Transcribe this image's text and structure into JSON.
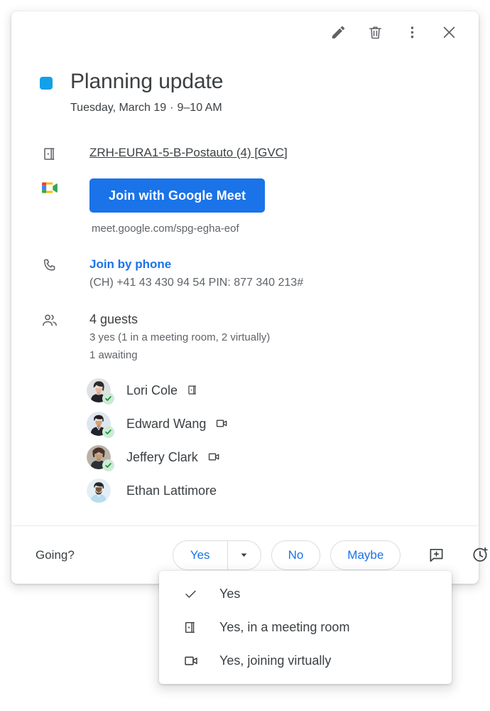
{
  "colors": {
    "event_dot": "#12a0e8",
    "primary_blue": "#1a73e8",
    "text_primary": "#3c4043",
    "text_secondary": "#5f6368",
    "rsvp_yes_badge": "#ceead6",
    "rsvp_check": "#1e8e3e",
    "meet_blue": "#1a73e8",
    "meet_red": "#ea4335",
    "meet_yellow": "#fbbc04",
    "meet_green": "#34a853"
  },
  "topbar": {
    "edit_label": "Edit event",
    "delete_label": "Delete event",
    "more_label": "More options",
    "close_label": "Close"
  },
  "event": {
    "title": "Planning update",
    "date": "Tuesday, March 19",
    "separator": "·",
    "time": "9–10 AM",
    "location": "ZRH-EURA1-5-B-Postauto (4) [GVC]",
    "meet_button": "Join with Google Meet",
    "meet_url": "meet.google.com/spg-egha-eof",
    "phone_link": "Join by phone",
    "phone_number": "(CH) +41 43 430 94 54 PIN: 877 340 213#"
  },
  "guests": {
    "count_label": "4 guests",
    "yes_summary": "3 yes (1 in a meeting room, 2 virtually)",
    "awaiting_summary": "1 awaiting",
    "list": [
      {
        "name": "Lori Cole",
        "rsvp": "yes",
        "mode": "room",
        "avatar": "woman-dark-hair"
      },
      {
        "name": "Edward Wang",
        "rsvp": "yes",
        "mode": "video",
        "avatar": "man-short-hair"
      },
      {
        "name": "Jeffery Clark",
        "rsvp": "yes",
        "mode": "video",
        "avatar": "man-curly-hair"
      },
      {
        "name": "Ethan Lattimore",
        "rsvp": "awaiting",
        "mode": "none",
        "avatar": "man-beard"
      }
    ]
  },
  "footer": {
    "going_label": "Going?",
    "yes_label": "Yes",
    "no_label": "No",
    "maybe_label": "Maybe",
    "add_note_label": "Add note",
    "propose_time_label": "Propose a new time"
  },
  "menu": {
    "items": [
      {
        "label": "Yes",
        "icon": "check-icon",
        "selected": true
      },
      {
        "label": "Yes, in a meeting room",
        "icon": "meeting-room-icon",
        "selected": false
      },
      {
        "label": "Yes, joining virtually",
        "icon": "video-camera-icon",
        "selected": false
      }
    ]
  }
}
